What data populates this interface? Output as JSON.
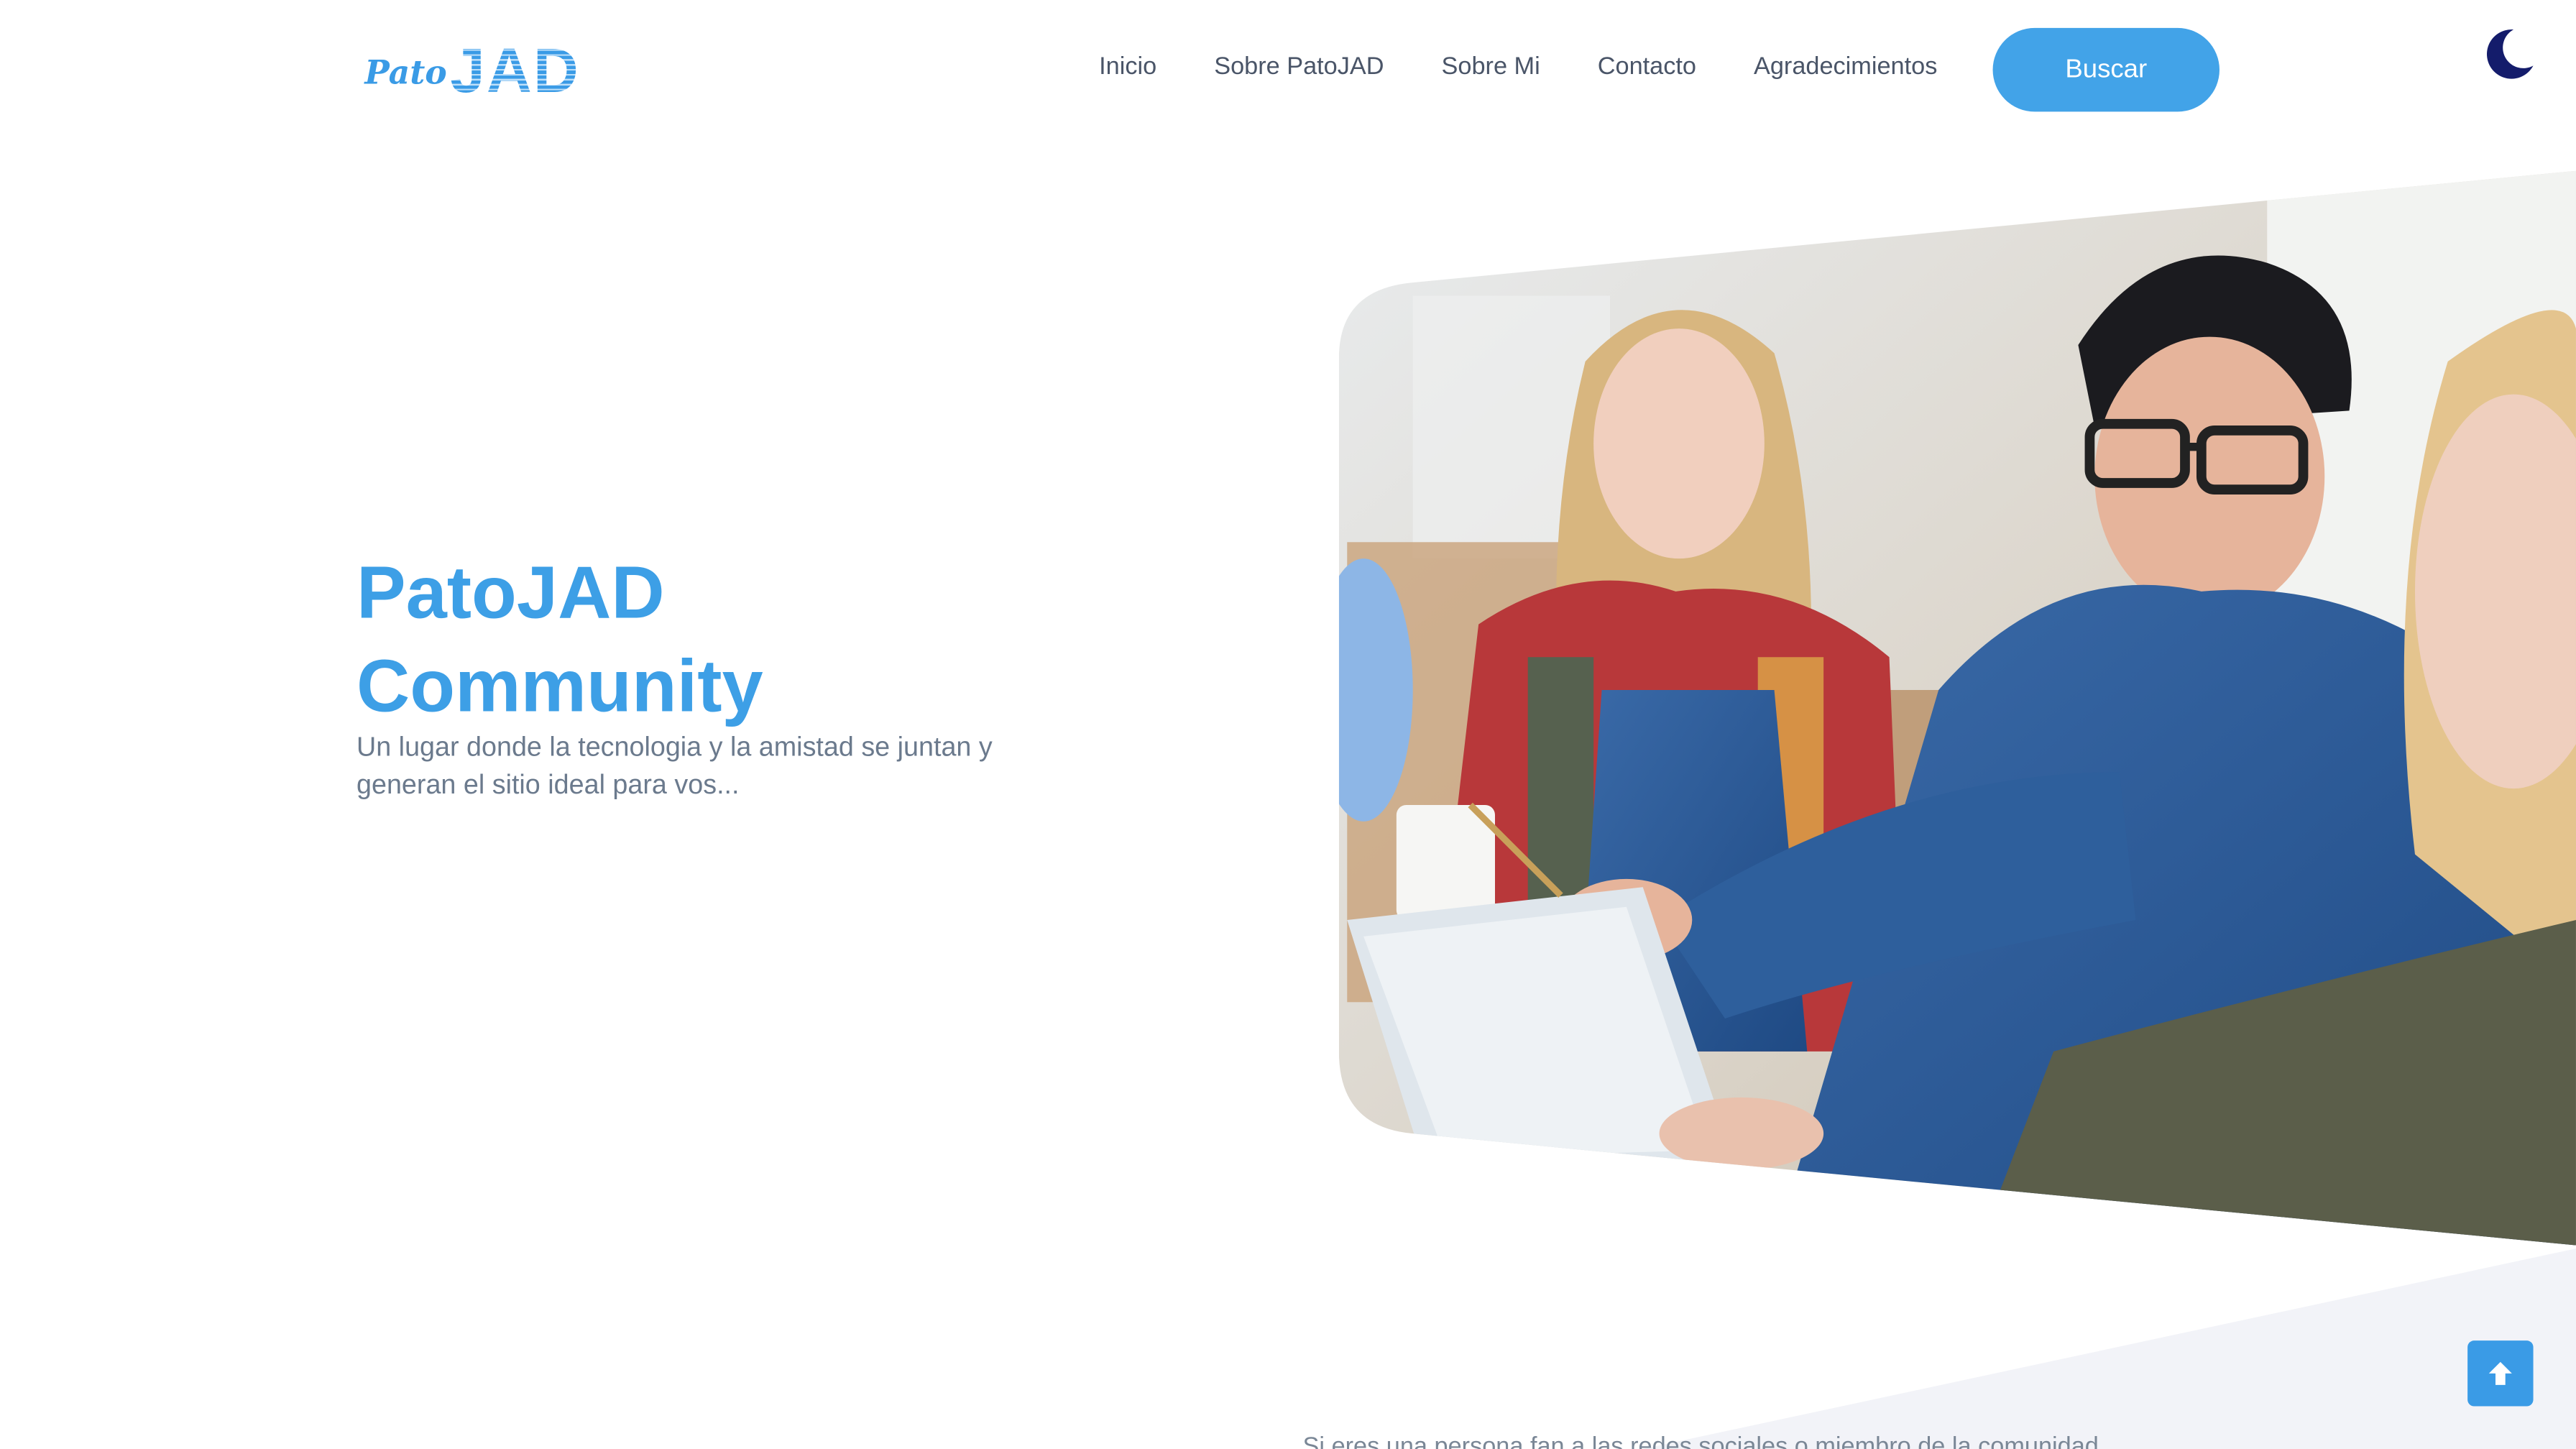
{
  "header": {
    "logo": {
      "small_text": "Pato",
      "big_text": "JAD",
      "color": "#3a9be6"
    },
    "nav": [
      {
        "label": "Inicio"
      },
      {
        "label": "Sobre PatoJAD"
      },
      {
        "label": "Sobre Mi"
      },
      {
        "label": "Contacto"
      },
      {
        "label": "Agradecimientos"
      }
    ],
    "search_button": {
      "label": "Buscar",
      "color": "#42a3e8"
    },
    "theme_toggle_icon": "moon-icon"
  },
  "hero": {
    "title_line1": "PatoJAD",
    "title_line2": "Community",
    "subtitle": "Un lugar donde la tecnologia y la amistad se juntan y generan el sitio ideal para vos...",
    "title_color": "#3d9fe6"
  },
  "section_preview_text": "Si eres una persona fan a las redes sociales o miembro de la comunidad...",
  "scroll_top_icon": "arrow-up-icon"
}
